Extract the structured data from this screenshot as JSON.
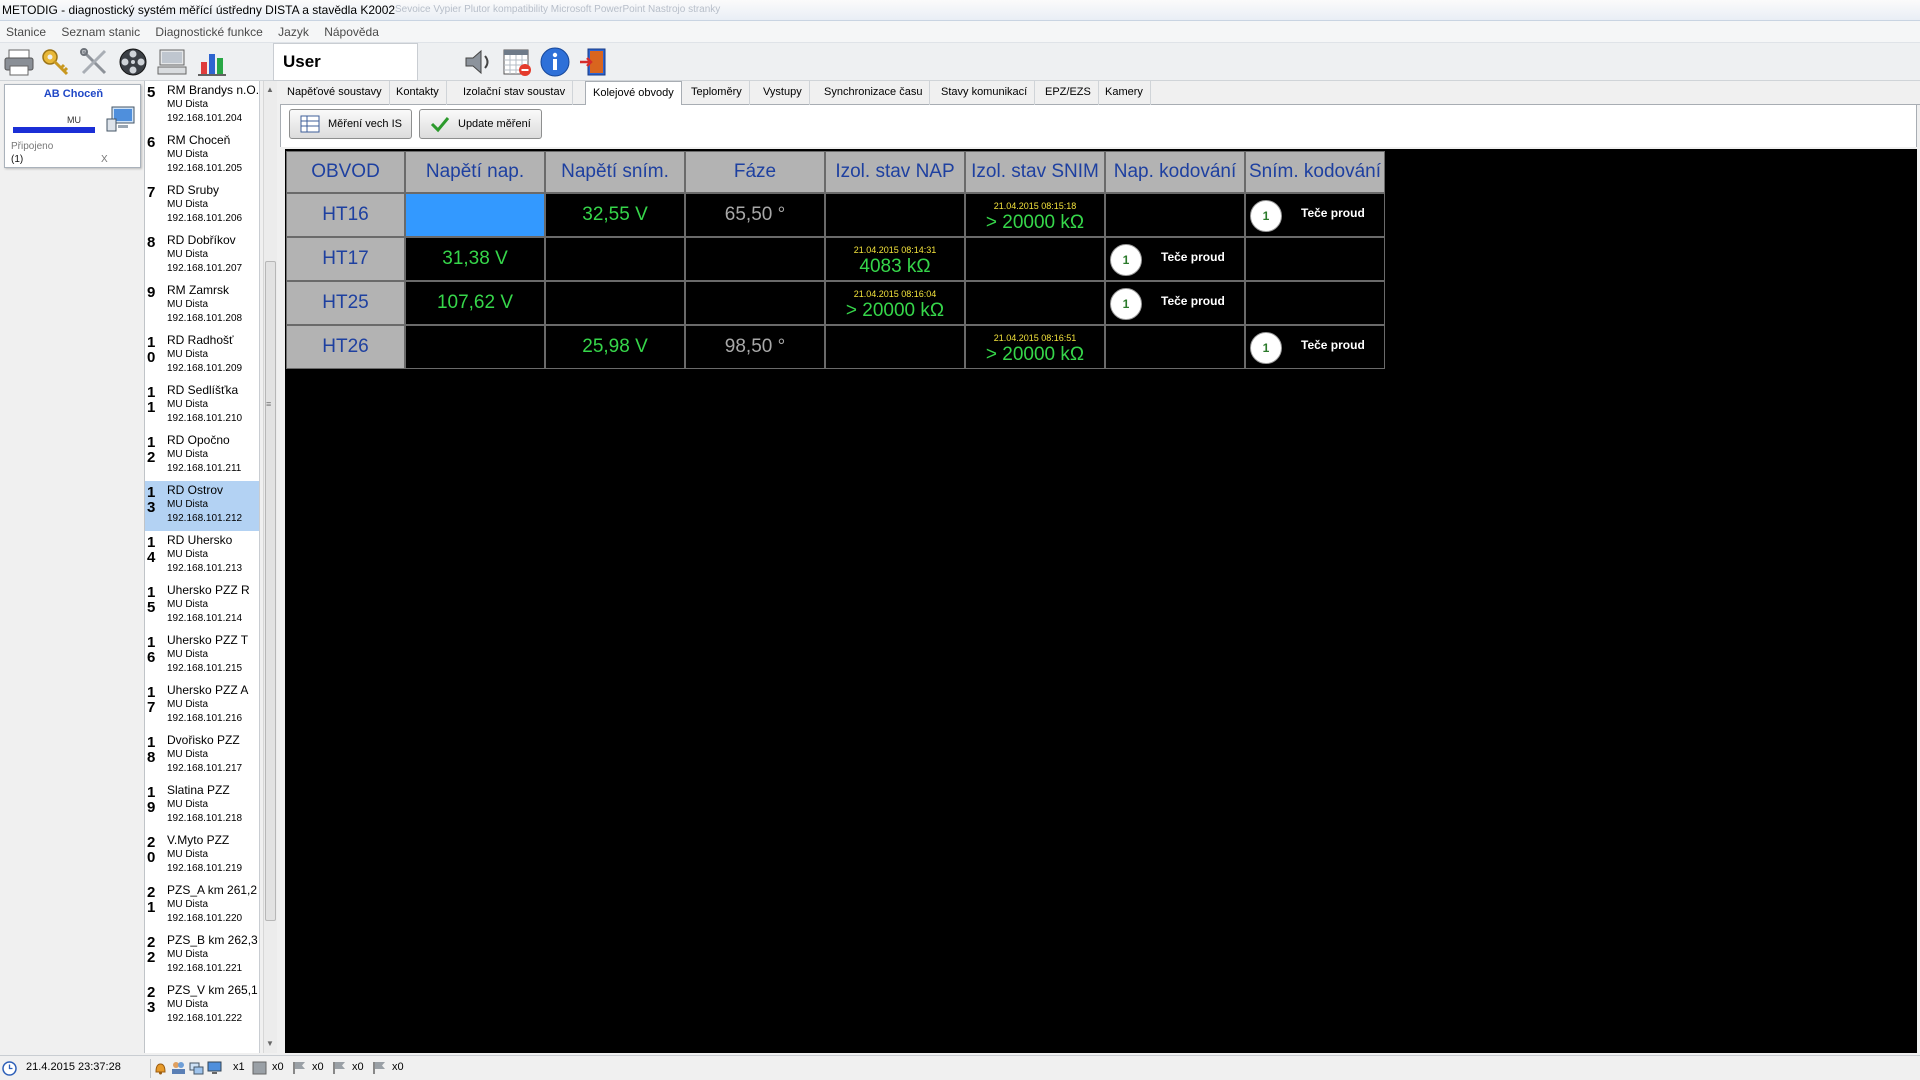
{
  "window": {
    "title": "METODIG - diagnostický systém měřící ústředny DISTA a stavědla K2002",
    "ghost_title": "Sevoice Vypier  Plutor kompatibility   Microsoft PowerPoint            Nastrojo stranky"
  },
  "menu": [
    "Stanice",
    "Seznam stanic",
    "Diagnostické funkce",
    "Jazyk",
    "Nápověda"
  ],
  "toolbar_icons": [
    "printer-icon",
    "key-icon",
    "tools-icon",
    "film-reel-icon",
    "keyboard-icon",
    "chart-icon"
  ],
  "toolbar2_icons": [
    "speaker-icon",
    "calendar-remove-icon",
    "info-icon",
    "exit-door-icon"
  ],
  "user": {
    "label": "User"
  },
  "station_card": {
    "name": "AB Choceň",
    "mu_label": "MU",
    "progress": 1.0,
    "status": "Připojeno",
    "count": "(1)",
    "close": "X"
  },
  "stations": [
    {
      "num": "5",
      "name": "RM Brandys n.O.",
      "type": "MU Dista",
      "ip": "192.168.101.204"
    },
    {
      "num": "6",
      "name": "RM Choceň",
      "type": "MU Dista",
      "ip": "192.168.101.205"
    },
    {
      "num": "7",
      "name": "RD Sruby",
      "type": "MU Dista",
      "ip": "192.168.101.206"
    },
    {
      "num": "8",
      "name": "RD Dobříkov",
      "type": "MU Dista",
      "ip": "192.168.101.207"
    },
    {
      "num": "9",
      "name": "RM Zamrsk",
      "type": "MU Dista",
      "ip": "192.168.101.208"
    },
    {
      "num": "10",
      "name": "RD Radhošť",
      "type": "MU Dista",
      "ip": "192.168.101.209"
    },
    {
      "num": "11",
      "name": "RD Sedlíšťka",
      "type": "MU Dista",
      "ip": "192.168.101.210"
    },
    {
      "num": "12",
      "name": "RD Opočno",
      "type": "MU Dista",
      "ip": "192.168.101.211"
    },
    {
      "num": "13",
      "name": "RD Ostrov",
      "type": "MU Dista",
      "ip": "192.168.101.212"
    },
    {
      "num": "14",
      "name": "RD Uhersko",
      "type": "MU Dista",
      "ip": "192.168.101.213"
    },
    {
      "num": "15",
      "name": "Uhersko PZZ R",
      "type": "MU Dista",
      "ip": "192.168.101.214"
    },
    {
      "num": "16",
      "name": "Uhersko PZZ T",
      "type": "MU Dista",
      "ip": "192.168.101.215"
    },
    {
      "num": "17",
      "name": "Uhersko PZZ A",
      "type": "MU Dista",
      "ip": "192.168.101.216"
    },
    {
      "num": "18",
      "name": "Dvořisko PZZ",
      "type": "MU Dista",
      "ip": "192.168.101.217"
    },
    {
      "num": "19",
      "name": "Slatina PZZ",
      "type": "MU Dista",
      "ip": "192.168.101.218"
    },
    {
      "num": "20",
      "name": "V.Myto PZZ",
      "type": "MU Dista",
      "ip": "192.168.101.219"
    },
    {
      "num": "21",
      "name": "PZS_A km 261,2",
      "type": "MU Dista",
      "ip": "192.168.101.220"
    },
    {
      "num": "22",
      "name": "PZS_B km 262,3",
      "type": "MU Dista",
      "ip": "192.168.101.221"
    },
    {
      "num": "23",
      "name": "PZS_V km 265,1",
      "type": "MU Dista",
      "ip": "192.168.101.222"
    }
  ],
  "selected_station": "13",
  "tabs": [
    "Napěťové soustavy",
    "Kontakty",
    "Izolační stav soustav",
    "Kolejové obvody",
    "Teploměry",
    "Vystupy",
    "Synchronizace času",
    "Stavy komunikací",
    "EPZ/EZS",
    "Kamery"
  ],
  "active_tab": "Kolejové obvody",
  "actions": {
    "measure_all": "Měření vech IS",
    "update": "Update měření"
  },
  "table": {
    "headers": [
      "OBVOD",
      "Napětí nap.",
      "Napětí sním.",
      "Fáze",
      "Izol. stav NAP",
      "Izol. stav SNIM",
      "Nap. kodování",
      "Sním. kodování"
    ],
    "rows": [
      {
        "circuit": "HT16",
        "u_nap": "",
        "u_snim": "32,55 V",
        "phase": "65,50 °",
        "iso_nap_ts": "",
        "iso_nap": "",
        "iso_snim_ts": "21.04.2015  08:15:18",
        "iso_snim": "> 20000 kΩ",
        "cod_nap_num": "",
        "cod_nap": "",
        "cod_snim_num": "1",
        "cod_snim": "Teče proud"
      },
      {
        "circuit": "HT17",
        "u_nap": "31,38 V",
        "u_snim": "",
        "phase": "",
        "iso_nap_ts": "21.04.2015  08:14:31",
        "iso_nap": "4083 kΩ",
        "iso_snim_ts": "",
        "iso_snim": "",
        "cod_nap_num": "1",
        "cod_nap": "Teče proud",
        "cod_snim_num": "",
        "cod_snim": ""
      },
      {
        "circuit": "HT25",
        "u_nap": "107,62 V",
        "u_snim": "",
        "phase": "",
        "iso_nap_ts": "21.04.2015  08:16:04",
        "iso_nap": "> 20000 kΩ",
        "iso_snim_ts": "",
        "iso_snim": "",
        "cod_nap_num": "1",
        "cod_nap": "Teče proud",
        "cod_snim_num": "",
        "cod_snim": ""
      },
      {
        "circuit": "HT26",
        "u_nap": "",
        "u_snim": "25,98 V",
        "phase": "98,50 °",
        "iso_nap_ts": "",
        "iso_nap": "",
        "iso_snim_ts": "21.04.2015  08:16:51",
        "iso_snim": "> 20000 kΩ",
        "cod_nap_num": "",
        "cod_nap": "",
        "cod_snim_num": "1",
        "cod_snim": "Teče proud"
      }
    ]
  },
  "status": {
    "datetime": "21.4.2015 23:37:28",
    "counters": [
      "x1",
      "x0",
      "x0",
      "x0",
      "x0"
    ]
  },
  "colors": {
    "header_bg": "#b3b3b3",
    "header_text": "#1e40a0",
    "value_green": "#36d64a",
    "value_gray": "#a8a8a8",
    "timestamp_yellow": "#f2e23c",
    "selected_cell": "#3399ff",
    "selected_station": "#b3d2f3"
  }
}
